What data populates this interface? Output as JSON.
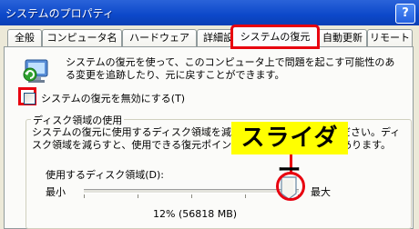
{
  "window": {
    "title": "システムのプロパティ",
    "help_label": "?"
  },
  "tabs": [
    {
      "label": "全般"
    },
    {
      "label": "コンピュータ名"
    },
    {
      "label": "ハードウェア"
    },
    {
      "label": "詳細設定"
    },
    {
      "label": "システムの復元",
      "active": true
    },
    {
      "label": "自動更新"
    },
    {
      "label": "リモート"
    }
  ],
  "restore": {
    "description": "システムの復元を使って、このコンピュータ上で問題を起こす可能性のある変更を追跡したり、元に戻すことができます。",
    "disable_label": "システムの復元を無効にする(T)",
    "disable_checked": false
  },
  "disk_usage": {
    "group_label": "ディスク領域の使用",
    "description": "システムの復元に使用するディスク領域を減らすには左に動かしてください。ディスク領域を減らすと、使用できる復元ポイントの数が減少する場合があります。",
    "slider_label": "使用するディスク領域(D):",
    "min_label": "最小",
    "max_label": "最大",
    "percent": 12,
    "size_text": "12% (56818 MB)"
  },
  "annotation": {
    "callout": "スライダー",
    "color": "#e8000f",
    "callout_bg": "#ffff00"
  }
}
